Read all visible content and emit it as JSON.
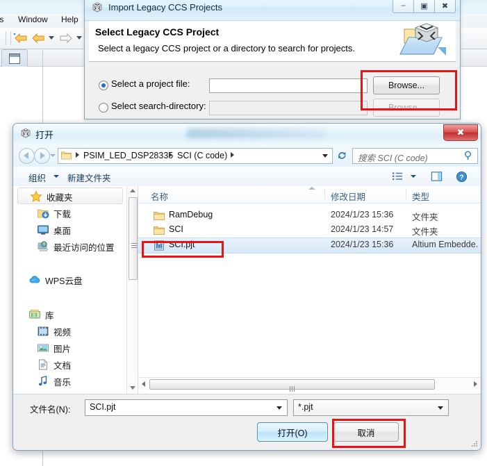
{
  "eclipse": {
    "menu": [
      {
        "label": "ts"
      },
      {
        "label": "Window"
      },
      {
        "label": "Help"
      }
    ]
  },
  "import_dialog": {
    "title": "Import Legacy CCS Projects",
    "title_icon": "ccs-cube-icon",
    "window_buttons": {
      "minimize": "–",
      "maximize": "▣",
      "close": "✖"
    },
    "heading": "Select Legacy CCS Project",
    "subheading": "Select a legacy CCS project or a directory to search for projects.",
    "header_icon": "import-folder-cube-icon",
    "options": [
      {
        "label": "Select a project file:",
        "selected": true,
        "value": "",
        "button": "Browse...",
        "button_enabled": true
      },
      {
        "label": "Select search-directory:",
        "selected": false,
        "value": "",
        "button": "Browse...",
        "button_enabled": false
      }
    ],
    "highlight_color": "#ee1111"
  },
  "open_dialog": {
    "title": "打开",
    "title_icon": "ccs-cube-icon",
    "close_label": "✖",
    "nav": {
      "back_icon": "back-arrow-icon",
      "forward_icon": "forward-arrow-icon",
      "history_icon": "chevron-down-icon",
      "refresh_icon": "refresh-icon",
      "folder_icon": "folder-icon",
      "breadcrumbs": [
        "PSIM_LED_DSP28335",
        "SCI (C code)"
      ],
      "address_caret_icon": "chevron-down-icon"
    },
    "search": {
      "placeholder": "搜索 SCI (C code)",
      "icon": "search-icon"
    },
    "toolbar": {
      "organize": "组织",
      "new_folder": "新建文件夹",
      "view_icon": "list-view-icon",
      "preview_icon": "preview-pane-icon",
      "help_icon": "help-icon"
    },
    "sidebar": [
      {
        "label": "收藏夹",
        "icon": "star-icon",
        "level": 0,
        "header": true
      },
      {
        "label": "下载",
        "icon": "downloads-icon",
        "level": 1
      },
      {
        "label": "桌面",
        "icon": "desktop-icon",
        "level": 1
      },
      {
        "label": "最近访问的位置",
        "icon": "recent-places-icon",
        "level": 1
      },
      {
        "label": "WPS云盘",
        "icon": "cloud-icon",
        "level": 0,
        "gap": true
      },
      {
        "label": "库",
        "icon": "library-icon",
        "level": 0,
        "gap": true
      },
      {
        "label": "视频",
        "icon": "video-icon",
        "level": 1
      },
      {
        "label": "图片",
        "icon": "pictures-icon",
        "level": 1
      },
      {
        "label": "文档",
        "icon": "documents-icon",
        "level": 1
      },
      {
        "label": "音乐",
        "icon": "music-icon",
        "level": 1
      }
    ],
    "columns": [
      "名称",
      "修改日期",
      "类型"
    ],
    "files": [
      {
        "name": "RamDebug",
        "date": "2024/1/23 15:36",
        "type": "文件夹",
        "icon": "folder-icon",
        "selected": false
      },
      {
        "name": "SCI",
        "date": "2024/1/23 14:57",
        "type": "文件夹",
        "icon": "folder-icon",
        "selected": false
      },
      {
        "name": "SCI.pjt",
        "date": "2024/1/23 15:36",
        "type": "Altium Embedde...",
        "icon": "pjt-file-icon",
        "selected": true
      }
    ],
    "filename_label": "文件名(N):",
    "filename_value": "SCI.pjt",
    "filetype_value": "*.pjt",
    "open_button": "打开(O)",
    "cancel_button": "取消",
    "highlight_color": "#ee1111"
  }
}
